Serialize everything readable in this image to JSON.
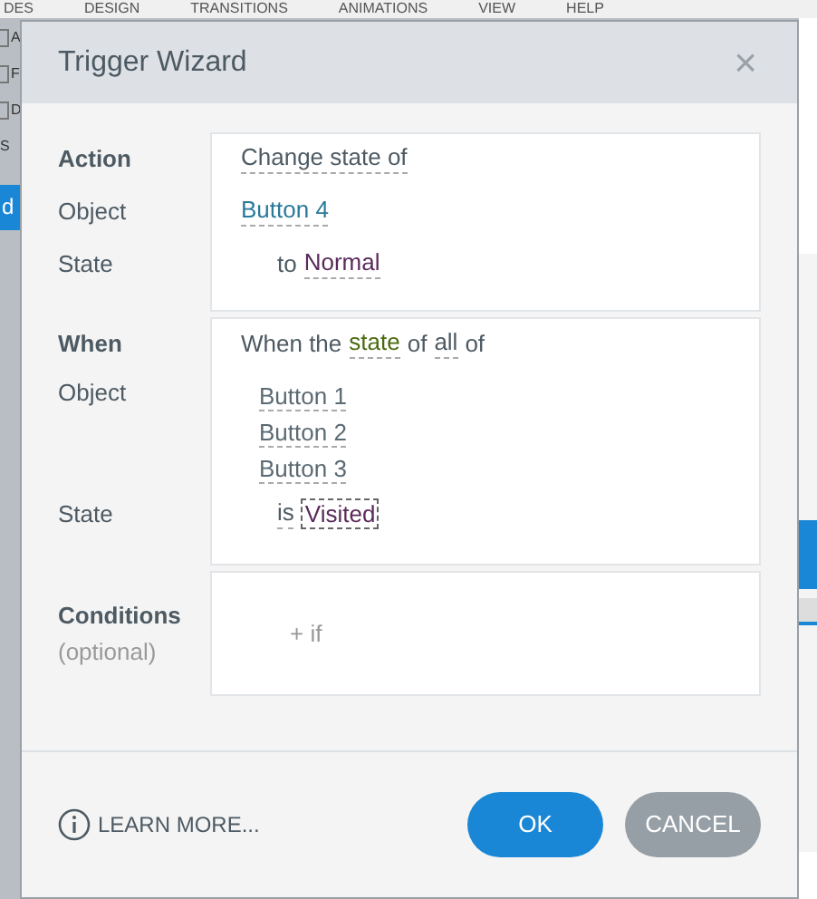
{
  "app_menu": [
    "DES",
    "DESIGN",
    "TRANSITIONS",
    "ANIMATIONS",
    "VIEW",
    "HELP"
  ],
  "left_panel": [
    {
      "label": "A",
      "kind": "checkbox",
      "checked": false
    },
    {
      "label": "F",
      "kind": "checkbox",
      "checked": false
    },
    {
      "label": "D",
      "kind": "checkbox",
      "checked": false
    },
    {
      "label": "S",
      "kind": "text"
    },
    {
      "label": "d",
      "kind": "highlight"
    }
  ],
  "dialog": {
    "title": "Trigger Wizard",
    "close": "×",
    "action": {
      "heading": "Action",
      "phrase": [
        {
          "text": "Change state of",
          "kind": "choice"
        }
      ],
      "object_label": "Object",
      "objects": [
        {
          "text": "Button 4",
          "color": "#2a7a9b"
        }
      ],
      "state_label": "State",
      "state_prefix": "to",
      "state": "Normal",
      "state_focused": false
    },
    "when": {
      "heading": "When",
      "phrase": [
        {
          "text": "When the",
          "kind": "plain"
        },
        {
          "text": "state",
          "kind": "term"
        },
        {
          "text": "of",
          "kind": "plain"
        },
        {
          "text": "all",
          "kind": "choice"
        },
        {
          "text": "of",
          "kind": "plain"
        }
      ],
      "object_label": "Object",
      "objects": [
        {
          "text": "Button 1",
          "color": "#5b6a73"
        },
        {
          "text": "Button 2",
          "color": "#5b6a73"
        },
        {
          "text": "Button 3",
          "color": "#5b6a73"
        }
      ],
      "state_label": "State",
      "state_prefix": "is",
      "state": "Visited",
      "state_focused": true
    },
    "conditions": {
      "heading": "Conditions",
      "note": "(optional)",
      "add": "+ if"
    },
    "learn_more": "LEARN MORE...",
    "buttons": [
      {
        "label": "OK",
        "kind": "primary"
      },
      {
        "label": "CANCEL",
        "kind": "secondary"
      }
    ]
  }
}
